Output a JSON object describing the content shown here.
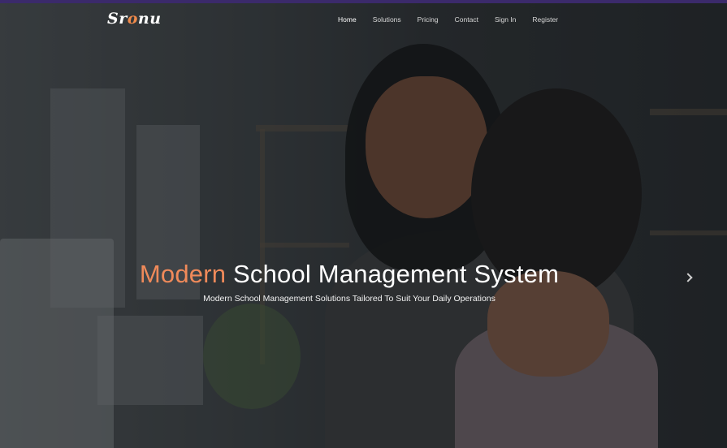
{
  "brand": {
    "logo_text_before": "Sr",
    "logo_text_o": "o",
    "logo_text_after": "nu",
    "accent_color": "#f08a5a"
  },
  "nav": {
    "items": [
      {
        "label": "Home",
        "active": true
      },
      {
        "label": "Solutions",
        "active": false
      },
      {
        "label": "Pricing",
        "active": false
      },
      {
        "label": "Contact",
        "active": false
      },
      {
        "label": "Sign In",
        "active": false
      },
      {
        "label": "Register",
        "active": false
      }
    ]
  },
  "hero": {
    "headline_accent": "Modern",
    "headline_rest": " School Management System",
    "subheadline": "Modern School Management Solutions Tailored To Suit Your Daily Operations",
    "next_slide_icon": "chevron-right-icon"
  }
}
